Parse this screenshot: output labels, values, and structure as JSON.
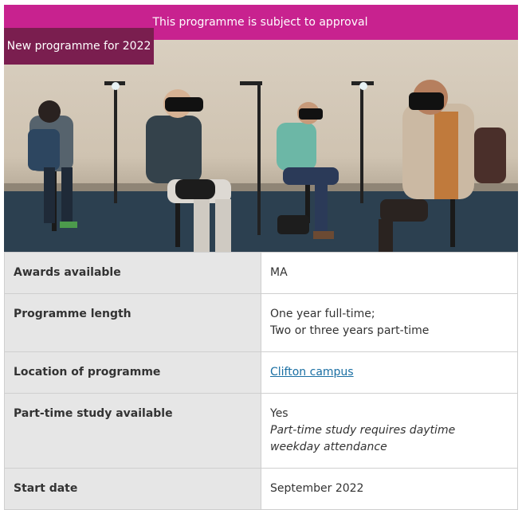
{
  "banner": {
    "approval_text": "This programme is subject to approval"
  },
  "badge": {
    "text": "New programme for 2022"
  },
  "details": {
    "awards": {
      "label": "Awards available",
      "value": "MA"
    },
    "length": {
      "label": "Programme length",
      "line1": "One year full-time;",
      "line2": "Two or three years part-time"
    },
    "location": {
      "label": "Location of programme",
      "link": "Clifton campus"
    },
    "parttime": {
      "label": "Part-time study available",
      "value": "Yes",
      "note": "Part-time study requires daytime weekday attendance"
    },
    "start": {
      "label": "Start date",
      "value": "September 2022"
    }
  },
  "colors": {
    "banner": "#c8228f",
    "badge": "#7a1e4f",
    "link": "#1a6fa3"
  }
}
